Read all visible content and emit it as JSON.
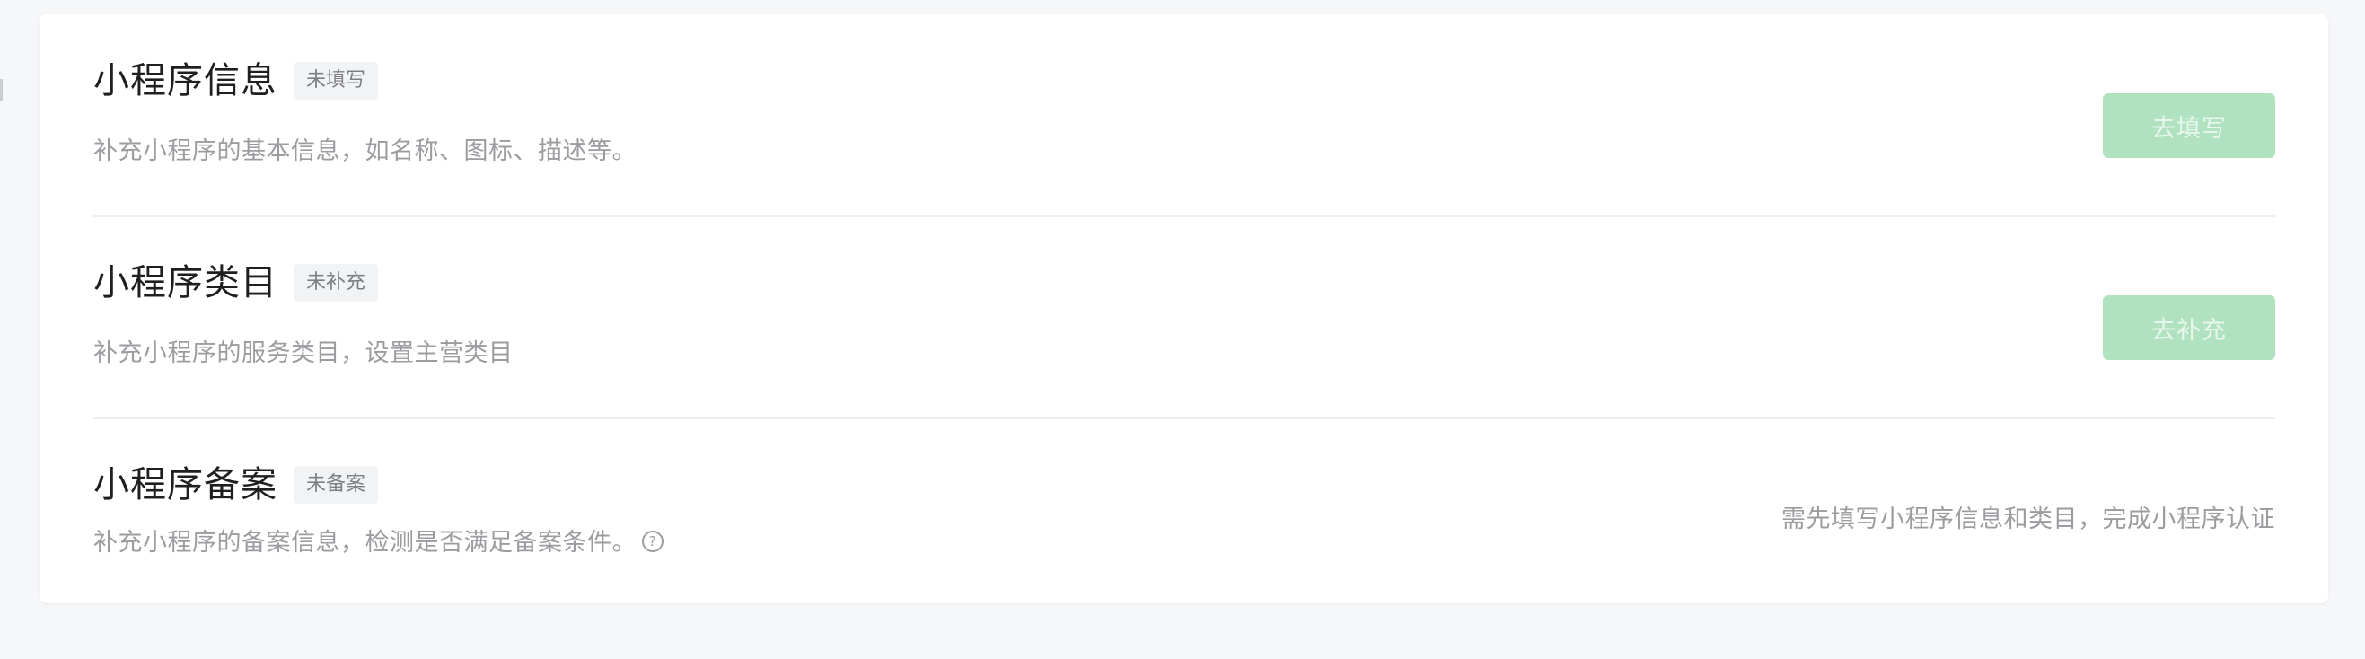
{
  "sections": [
    {
      "title": "小程序信息",
      "badge": "未填写",
      "description": "补充小程序的基本信息，如名称、图标、描述等。",
      "action_label": "去填写"
    },
    {
      "title": "小程序类目",
      "badge": "未补充",
      "description": "补充小程序的服务类目，设置主营类目",
      "action_label": "去补充"
    },
    {
      "title": "小程序备案",
      "badge": "未备案",
      "description": "补充小程序的备案信息，检测是否满足备案条件。",
      "note": "需先填写小程序信息和类目，完成小程序认证",
      "help_icon": "?"
    }
  ],
  "colors": {
    "action_disabled_bg": "#b0e2bf",
    "text_primary": "#1f1f1f",
    "text_secondary": "#9a9c9f"
  }
}
